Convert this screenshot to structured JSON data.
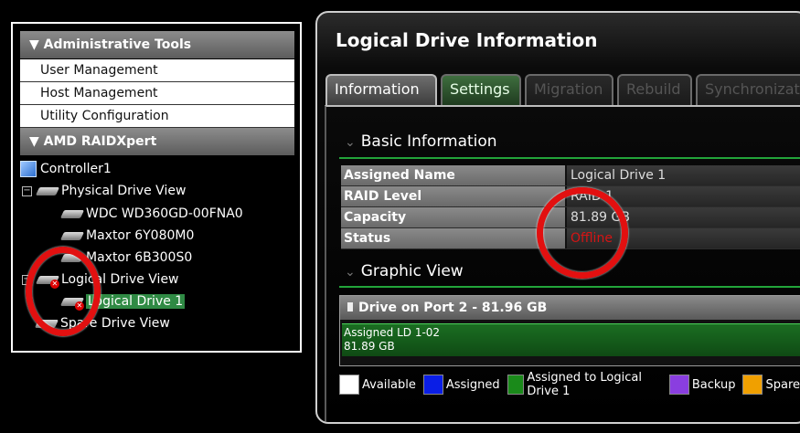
{
  "left_panel": {
    "admin_header": "▼ Administrative Tools",
    "admin_items": [
      "User Management",
      "Host Management",
      "Utility Configuration"
    ],
    "raid_header": "▼ AMD RAIDXpert",
    "tree": {
      "controller": "Controller1",
      "expander": "−",
      "physical_view": "Physical Drive View",
      "drives": [
        "WDC WD360GD-00FNA0",
        "Maxtor 6Y080M0",
        "Maxtor 6B300S0"
      ],
      "logical_view": "Logical Drive View",
      "logical_drive": "Logical Drive 1",
      "spare_view": "Spare Drive View"
    }
  },
  "right_panel": {
    "title": "Logical Drive Information",
    "tabs": [
      "Information",
      "Settings",
      "Migration",
      "Rebuild",
      "Synchronizati"
    ],
    "basic_info": {
      "heading": "Basic Information",
      "rows": [
        {
          "key": "Assigned Name",
          "value": "Logical Drive 1"
        },
        {
          "key": "RAID Level",
          "value": "RAID 1"
        },
        {
          "key": "Capacity",
          "value": "81.89 GB"
        },
        {
          "key": "Status",
          "value": "Offline"
        }
      ]
    },
    "graphic_view": {
      "heading": "Graphic View",
      "drive_title": "Drive on Port 2 - 81.96 GB",
      "bar_line1": "Assigned LD 1-02",
      "bar_line2": "81.89 GB"
    },
    "legend": [
      {
        "label": "Available",
        "color": "#ffffff"
      },
      {
        "label": "Assigned",
        "color": "#0a1ee6"
      },
      {
        "label": "Assigned to Logical Drive 1",
        "color": "#1a8a1a"
      },
      {
        "label": "Backup",
        "color": "#8a3ee0"
      },
      {
        "label": "Spare",
        "color": "#f0a000"
      }
    ]
  },
  "colors": {
    "accent_green": "#22a43a",
    "offline_red": "#d51414",
    "annotation_red": "#e21010"
  }
}
